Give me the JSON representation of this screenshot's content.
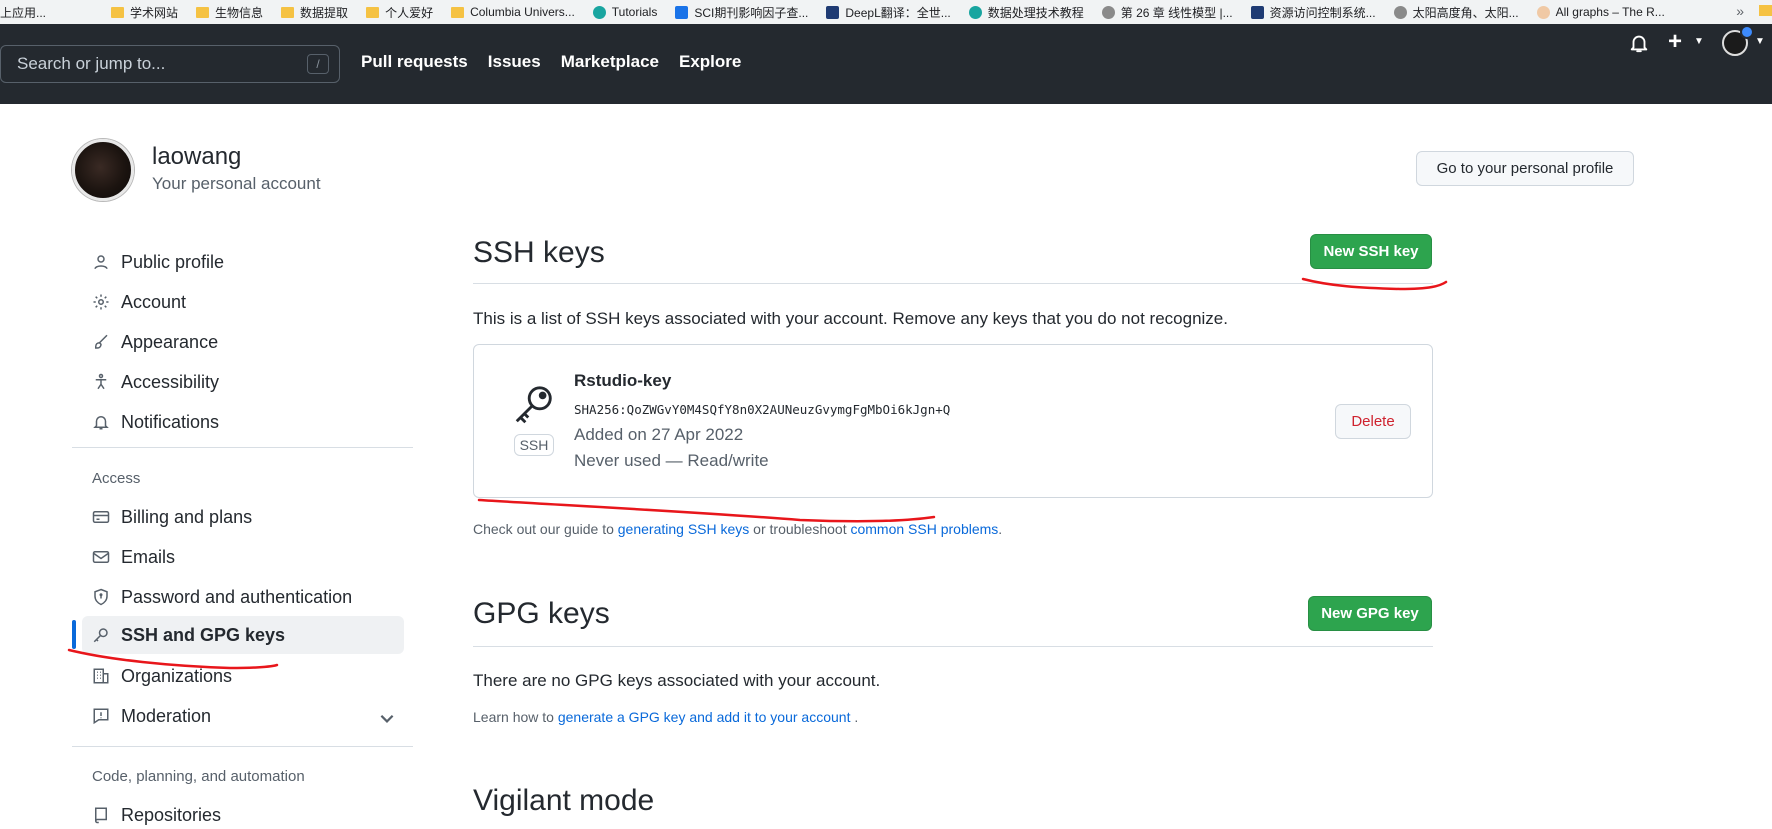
{
  "bookmarks": [
    {
      "label": "上应用...",
      "icon": "folder-icon"
    },
    {
      "label": "学术网站",
      "icon": "folder-icon"
    },
    {
      "label": "生物信息",
      "icon": "folder-icon"
    },
    {
      "label": "数据提取",
      "icon": "folder-icon"
    },
    {
      "label": "个人爱好",
      "icon": "folder-icon"
    },
    {
      "label": "Columbia Univers...",
      "icon": "folder-icon"
    },
    {
      "label": "Tutorials",
      "icon": "site-icon"
    },
    {
      "label": "SCI期刊影响因子查...",
      "icon": "site-icon"
    },
    {
      "label": "DeepL翻译：全世...",
      "icon": "site-icon"
    },
    {
      "label": "数据处理技术教程",
      "icon": "site-icon"
    },
    {
      "label": "第 26 章 线性模型 |...",
      "icon": "site-icon"
    },
    {
      "label": "资源访问控制系统...",
      "icon": "site-icon"
    },
    {
      "label": "太阳高度角、太阳...",
      "icon": "site-icon"
    },
    {
      "label": "All graphs – The R...",
      "icon": "site-icon"
    }
  ],
  "bookmarks_more": "»",
  "header": {
    "search_placeholder": "Search or jump to...",
    "search_shortcut": "/",
    "nav": [
      "Pull requests",
      "Issues",
      "Marketplace",
      "Explore"
    ]
  },
  "user": {
    "name": "laowang",
    "subtitle": "Your personal account",
    "profile_button": "Go to your personal profile"
  },
  "sidebar": {
    "items_top": [
      "Public profile",
      "Account",
      "Appearance",
      "Accessibility",
      "Notifications"
    ],
    "access_heading": "Access",
    "items_access": [
      "Billing and plans",
      "Emails",
      "Password and authentication",
      "SSH and GPG keys",
      "Organizations",
      "Moderation"
    ],
    "code_heading": "Code, planning, and automation",
    "items_code": [
      "Repositories"
    ]
  },
  "ssh": {
    "title": "SSH keys",
    "new_button": "New SSH key",
    "description": "This is a list of SSH keys associated with your account. Remove any keys that you do not recognize.",
    "key": {
      "name": "Rstudio-key",
      "fingerprint": "SHA256:QoZWGvY0M4SQfY8n0X2AUNeuzGvymgFgMbOi6kJgn+Q",
      "added": "Added on 27 Apr 2022",
      "usage": "Never used — Read/write",
      "badge": "SSH",
      "delete_button": "Delete"
    },
    "guide_prefix": "Check out our guide to ",
    "guide_link1": "generating SSH keys",
    "guide_middle": " or troubleshoot ",
    "guide_link2": "common SSH problems",
    "guide_suffix": "."
  },
  "gpg": {
    "title": "GPG keys",
    "new_button": "New GPG key",
    "empty": "There are no GPG keys associated with your account.",
    "learn_prefix": "Learn how to ",
    "learn_link": "generate a GPG key and add it to your account",
    "learn_suffix": " ."
  },
  "vigilant": {
    "title": "Vigilant mode"
  },
  "colors": {
    "header_bg": "#24292f",
    "green": "#2da44e",
    "link": "#0969da",
    "danger": "#cf222e",
    "annotation": "#e8161b"
  }
}
